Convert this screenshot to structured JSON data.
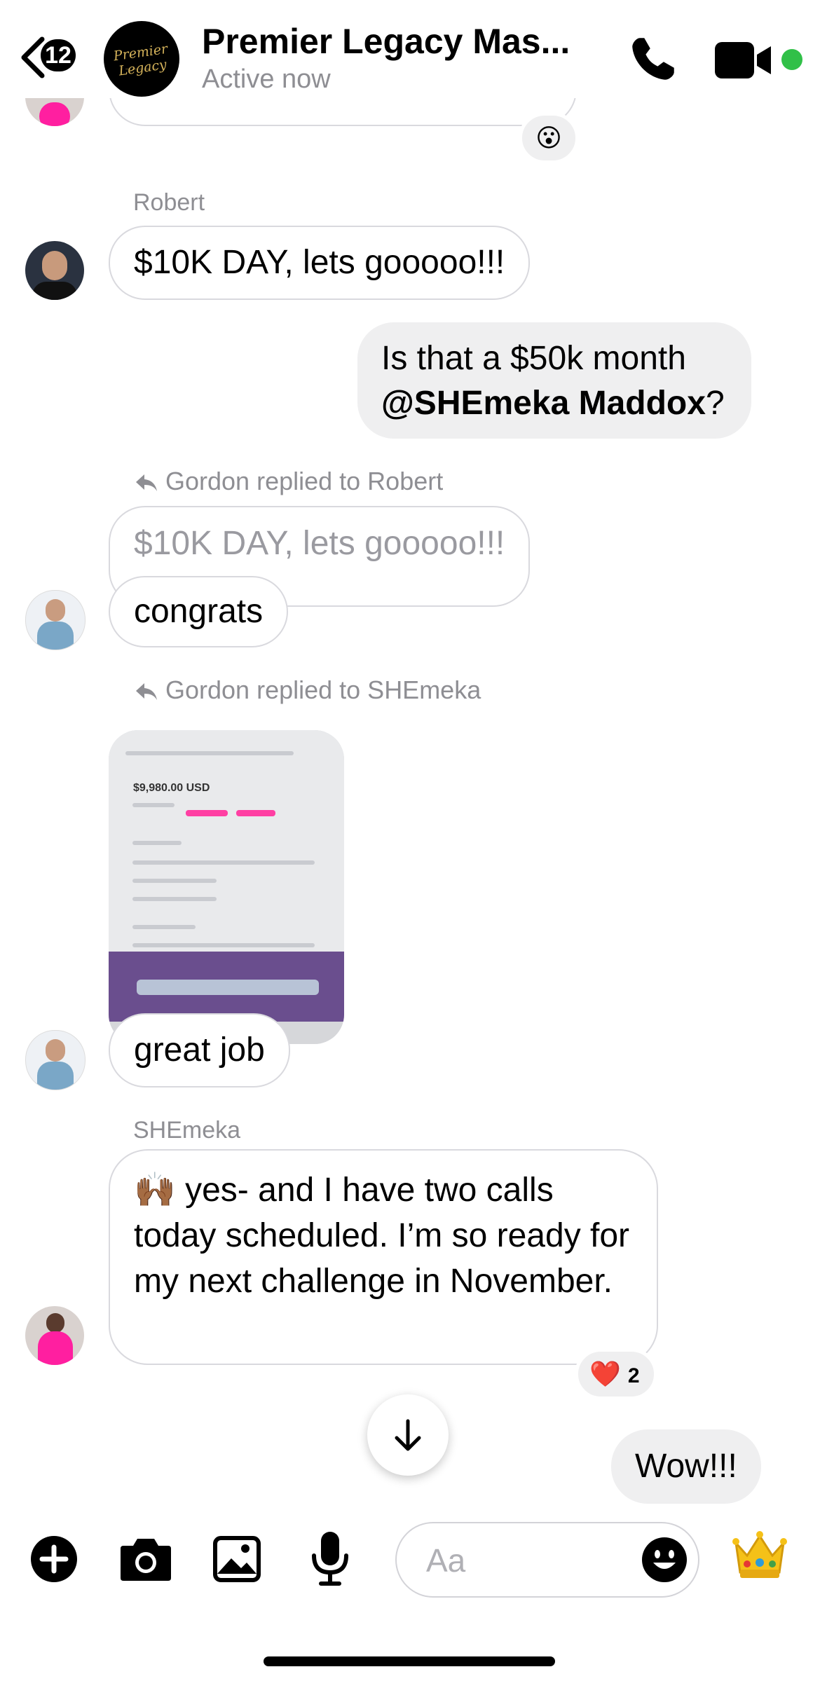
{
  "header": {
    "back_count": "12",
    "title": "Premier Legacy Mas...",
    "status": "Active now",
    "group_logo_text": "Premier Legacy"
  },
  "messages": {
    "top_reaction": "😮",
    "robert_name": "Robert",
    "robert_msg": "$10K DAY, lets gooooo!!!",
    "me_msg_prefix": "Is that a $50k month",
    "me_msg_mention": "@SHEmeka Maddox",
    "me_msg_suffix": "?",
    "reply1_label": "Gordon replied to Robert",
    "reply1_quote": "$10K DAY, lets gooooo!!!",
    "reply1_msg": "congrats",
    "reply2_label": "Gordon replied to SHEmeka",
    "photo_amount": "$9,980.00 USD",
    "reply2_msg": "great job",
    "shemeka_name": "SHEmeka",
    "shemeka_msg": "🙌🏾 yes- and I have two calls today scheduled.  I’m so ready for my next challenge in November.",
    "shemeka_reaction_emoji": "❤️",
    "shemeka_reaction_count": "2",
    "me_msg2": "Wow!!!"
  },
  "composer": {
    "placeholder": "Aa",
    "crown_emoji": "👑"
  },
  "icons": {
    "back": "chevron-left-icon",
    "call": "phone-icon",
    "video": "video-camera-icon",
    "add": "plus-circle-icon",
    "camera": "camera-icon",
    "gallery": "image-icon",
    "mic": "microphone-icon",
    "emoji": "smiley-icon",
    "scroll": "arrow-down-icon"
  },
  "colors": {
    "online": "#31c048",
    "outgoing_bubble": "#efeff0",
    "incoming_border": "#d9d9de",
    "secondary_text": "#8e8e93"
  }
}
